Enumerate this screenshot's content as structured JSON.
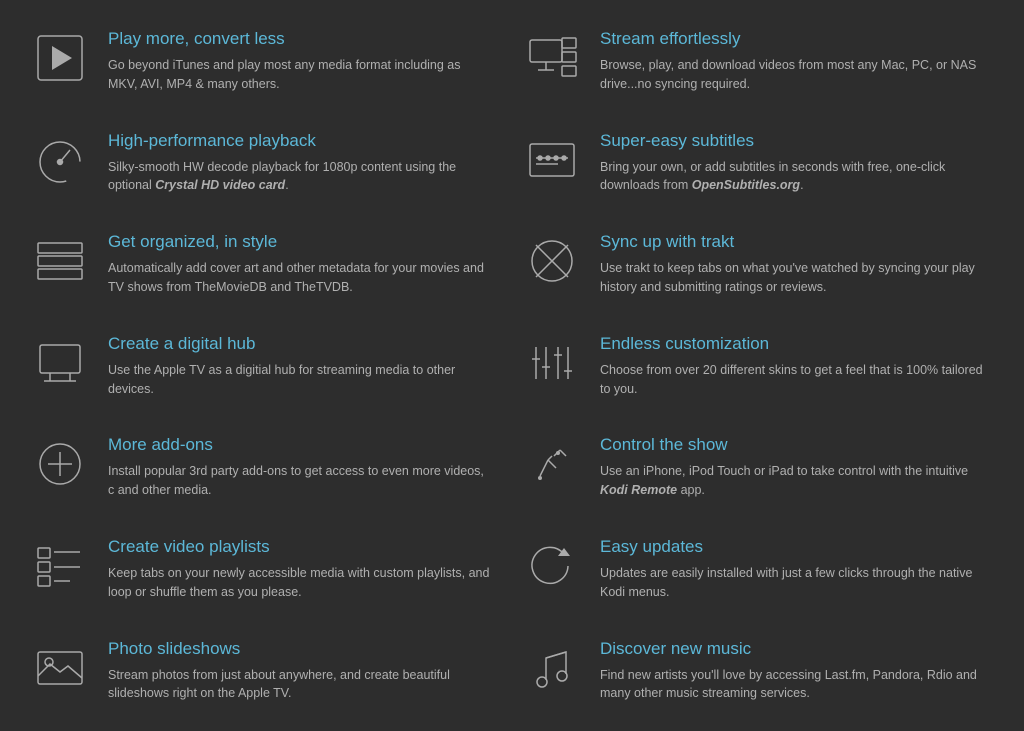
{
  "features": [
    {
      "id": "play-convert",
      "title": "Play more, convert less",
      "desc": "Go beyond iTunes and play most any media format including as MKV, AVI, MP4 & many others.",
      "desc_html": "Go beyond iTunes and play most any media format including as MKV, AVI, MP4 &amp; many others.",
      "icon": "play"
    },
    {
      "id": "stream-effortlessly",
      "title": "Stream effortlessly",
      "desc": "Browse, play, and download videos from most any Mac, PC, or NAS drive...no syncing required.",
      "icon": "stream"
    },
    {
      "id": "high-performance",
      "title": "High-performance playback",
      "desc_html": "Silky-smooth HW decode playback for 1080p content using the optional <strong>Crystal HD video card</strong>.",
      "icon": "speedometer"
    },
    {
      "id": "subtitles",
      "title": "Super-easy subtitles",
      "desc_html": "Bring your own, or add subtitles in seconds with free, one-click downloads from <em>OpenSubtitles.org</em>.",
      "icon": "subtitles"
    },
    {
      "id": "organized",
      "title": "Get organized, in style",
      "desc": "Automatically add cover art and other metadata for your movies and TV shows from TheMovieDB and TheTVDB.",
      "icon": "organize"
    },
    {
      "id": "trakt",
      "title": "Sync up with trakt",
      "desc": "Use trakt to keep tabs on what you've watched by syncing your play history and submitting ratings or reviews.",
      "icon": "trakt"
    },
    {
      "id": "digital-hub",
      "title": "Create a digital hub",
      "desc": "Use the Apple TV as a digitial hub for streaming media to other devices.",
      "icon": "hub"
    },
    {
      "id": "customization",
      "title": "Endless customization",
      "desc": "Choose from over 20 different skins to get a feel that is 100% tailored to you.",
      "icon": "sliders"
    },
    {
      "id": "addons",
      "title": "More add-ons",
      "desc": "Install popular 3rd party add-ons to get access to even more videos, c and other media.",
      "icon": "plus-circle"
    },
    {
      "id": "control",
      "title": "Control the show",
      "desc_html": "Use an iPhone, iPod Touch or iPad to take control with the intuitive <strong>Kodi Remote</strong> app.",
      "icon": "remote"
    },
    {
      "id": "playlists",
      "title": "Create video playlists",
      "desc": "Keep tabs on your newly accessible media with custom playlists, and loop or shuffle them as you please.",
      "icon": "playlist"
    },
    {
      "id": "updates",
      "title": "Easy updates",
      "desc": "Updates are easily installed with just a few clicks through the native Kodi menus.",
      "icon": "refresh"
    },
    {
      "id": "slideshows",
      "title": "Photo slideshows",
      "desc": "Stream photos from just about anywhere, and create beautiful slideshows right on the Apple TV.",
      "icon": "photo"
    },
    {
      "id": "music",
      "title": "Discover new music",
      "desc": "Find new artists you'll love by accessing Last.fm, Pandora, Rdio and many other music streaming services.",
      "icon": "music"
    }
  ]
}
